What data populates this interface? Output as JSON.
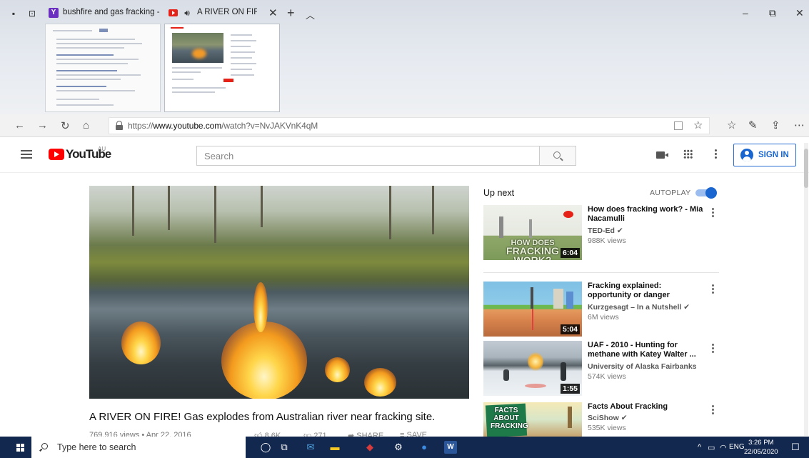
{
  "browser": {
    "tabs": [
      {
        "title": "bushfire and gas fracking - ",
        "active": false,
        "favicon": "yahoo-icon"
      },
      {
        "title": "A RIVER ON FIRE! G",
        "active": true,
        "favicon": "youtube-icon",
        "audio": true
      }
    ],
    "new_tab_label": "+",
    "tab_chevron": "^",
    "window_controls": {
      "minimize": "–",
      "restore": "⧉",
      "close": "✕"
    },
    "url_prefix": "https://",
    "url_host": "www.youtube.com",
    "url_rest": "/watch?v=NvJAKVnK4qM"
  },
  "youtube": {
    "logo_text": "YouTube",
    "country": "AU",
    "search_placeholder": "Search",
    "signin_label": "SIGN IN",
    "video": {
      "title": "A RIVER ON FIRE! Gas explodes from Australian river near fracking site.",
      "meta": "769,916 views • Apr 22, 2016",
      "likes": "8.6K",
      "dislikes": "271",
      "share": "SHARE",
      "save": "SAVE"
    },
    "up_next_label": "Up next",
    "autoplay_label": "AUTOPLAY",
    "autoplay_on": true,
    "recommendations": [
      {
        "title": "How does fracking work? - Mia Nacamulli",
        "channel": "TED-Ed",
        "verified": true,
        "views": "988K views",
        "duration": "6:04",
        "thumb_text": "HOW DOES FRACKING WORK?"
      },
      {
        "title": "Fracking explained: opportunity or danger",
        "channel": "Kurzgesagt – In a Nutshell",
        "verified": true,
        "views": "6M views",
        "duration": "5:04"
      },
      {
        "title": "UAF - 2010 - Hunting for methane with Katey Walter ...",
        "channel": "University of Alaska Fairbanks",
        "verified": false,
        "views": "574K views",
        "duration": "1:55"
      },
      {
        "title": "Facts About Fracking",
        "channel": "SciShow",
        "verified": true,
        "views": "535K views",
        "thumb_text": "FACTS ABOUT FRACKING"
      }
    ]
  },
  "taskbar": {
    "search_placeholder": "Type here to search",
    "language": "ENG",
    "time": "3:26 PM",
    "date": "22/05/2020"
  },
  "colors": {
    "youtube_red": "#ff0000",
    "signin_blue": "#1a66d0",
    "taskbar_bg": "#13284f"
  }
}
